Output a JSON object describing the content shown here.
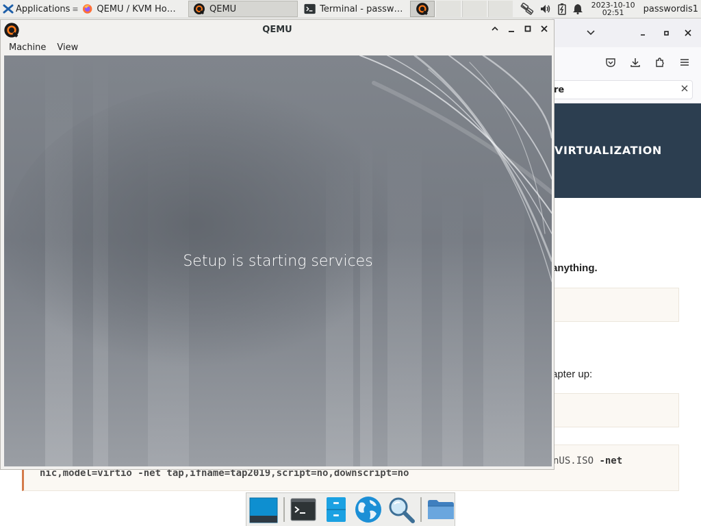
{
  "panel": {
    "apps_label": "Applications",
    "tasks": [
      {
        "label": "QEMU / KVM How ...",
        "icon": "firefox-icon"
      },
      {
        "label": "QEMU",
        "icon": "qemu-icon"
      },
      {
        "label": "Terminal - passwo...",
        "icon": "terminal-icon"
      }
    ],
    "clock_date": "2023-10-10",
    "clock_time": "02:51",
    "user": "passwordis1"
  },
  "browser": {
    "hero_text": "VIRTUALIZATION",
    "notice_partial": "re",
    "text_1": "anything.",
    "text_2": "apter up:",
    "code_tail_plain": "nUS.ISO ",
    "code_tail_bold": "-net"
  },
  "code": {
    "line": "nic,model=virtio -net tap,ifname=tap2019,script=no,downscript=no"
  },
  "qemu": {
    "title": "QEMU",
    "menu": [
      "Machine",
      "View"
    ],
    "screen_message": "Setup is starting services"
  },
  "dock": {
    "items": [
      "show-desktop-icon",
      "terminal-icon",
      "file-cabinet-icon",
      "web-browser-icon",
      "app-finder-icon",
      "folder-icon"
    ]
  },
  "colors": {
    "panel_bg": "#eeeeec",
    "hero_bg": "#2c3e50",
    "code_accent": "#d47b4a"
  }
}
